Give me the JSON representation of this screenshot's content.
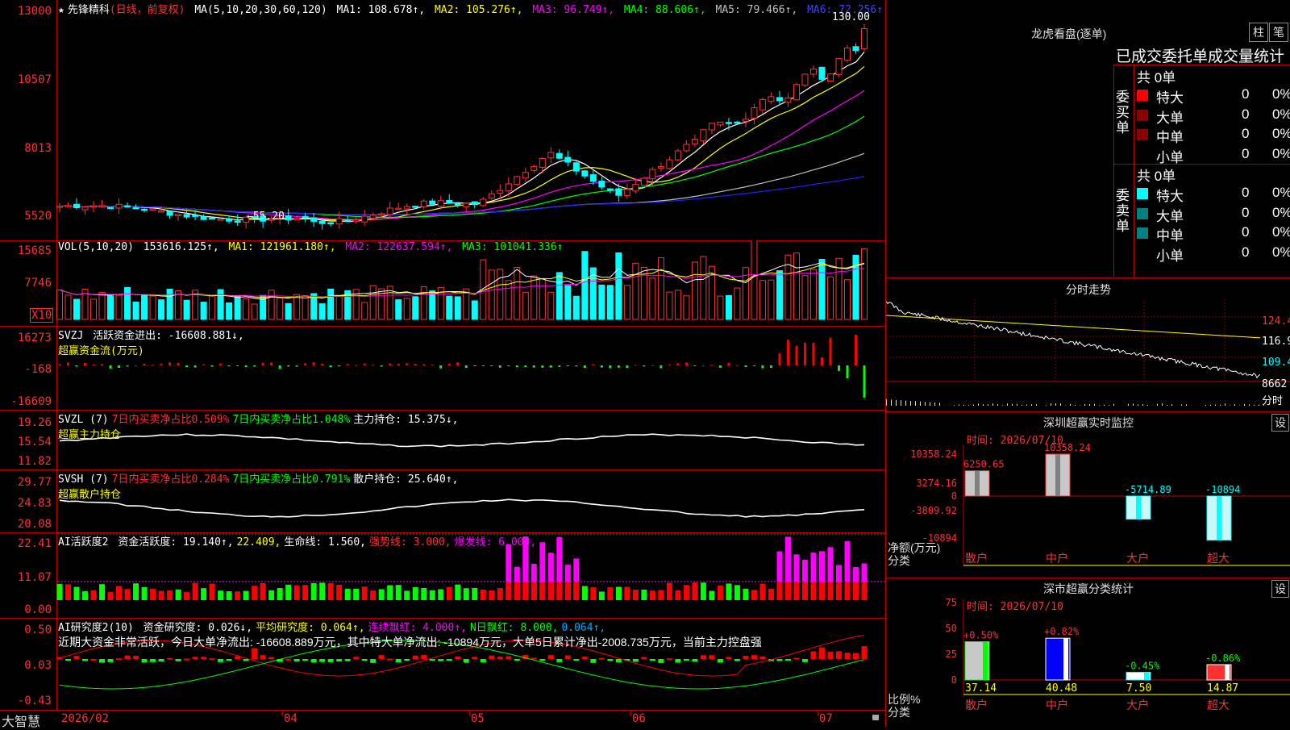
{
  "stock_name": "先锋精科",
  "period": "(日线，前复权)",
  "ma_legend": {
    "label": "MA(5,10,20,30,60,120)",
    "ma1": "MA1: 108.678↑,",
    "ma2": "MA2: 105.276↑,",
    "ma3": "MA3: 96.749↑,",
    "ma4": "MA4: 88.606↑,",
    "ma5": "MA5: 79.466↑,",
    "ma6": "MA6: 72.256↑"
  },
  "price_axis": [
    "13000",
    "10507",
    "8013",
    "5520"
  ],
  "high_label": "130.00",
  "low_label": "←55.20",
  "vol_legend": {
    "label": "VOL(5,10,20)",
    "vol": "153616.125↑,",
    "ma1": "MA1: 121961.180↑,",
    "ma2": "MA2: 122637.594↑,",
    "ma3": "MA3: 101041.336↑"
  },
  "vol_axis": [
    "15685",
    "7746"
  ],
  "vol_unit": "X10",
  "svzj": {
    "label": "SVZJ",
    "value": "活跃资金进出: -16608.881↓,",
    "sub": "超赢资金流(万元)",
    "axis": [
      "16273",
      "-168",
      "-16609"
    ]
  },
  "svzl": {
    "label": "SVZL (7)",
    "a": "7日内买卖净占比0.509%",
    "b": "7日内买卖净占比1.048%",
    "c": "主力持仓: 15.375↓,",
    "sub": "超赢主力持仓",
    "axis": [
      "19.26",
      "15.54",
      "11.82"
    ]
  },
  "svsh": {
    "label": "SVSH (7)",
    "a": "7日内买卖净占比0.284%",
    "b": "7日内买卖净占比0.791%",
    "c": "散户持仓: 25.640↑,",
    "sub": "超赢散户持仓",
    "axis": [
      "29.77",
      "24.83",
      "20.08"
    ]
  },
  "ai1": {
    "label": "AI活跃度2",
    "a": "资金活跃度: 19.140↑,",
    "b": "22.409,",
    "c": "生命线: 1.560,",
    "d": "强势线: 3.000,",
    "e": "爆发线: 6.000,",
    "axis": [
      "22.41",
      "11.07",
      "0.00"
    ]
  },
  "ai2": {
    "label": "AI研究度2(10)",
    "a": "资金研究度: 0.026↓,",
    "b": "平均研究度: 0.064↑,",
    "c": "连续飘红: 4.000↑,",
    "d": "N日飘红: 8.000,",
    "e": "0.064↑,",
    "note": "近期大资金非常活跃，今日大单净流出: -16608.889万元，其中特大单净流出: -10894万元，大单5日累计净出-2008.735万元，当前主力控盘强",
    "axis": [
      "0.50",
      "0.03",
      "-0.43"
    ]
  },
  "bottom": {
    "brand": "大智慧",
    "dates": [
      "2026/02",
      "04",
      "05",
      "06",
      "07"
    ]
  },
  "lhb": {
    "title": "龙虎看盘(逐单)",
    "btn1": "柱",
    "btn2": "笔",
    "header": "已成交委托单成交量统计",
    "buy_label": "委买单",
    "sell_label": "委卖单",
    "buy_total": "共 0单",
    "sell_total": "共 0单",
    "buy_rows": [
      {
        "name": "特大",
        "v": "0",
        "p": "0%"
      },
      {
        "name": "大单",
        "v": "0",
        "p": "0%"
      },
      {
        "name": "中单",
        "v": "0",
        "p": "0%"
      },
      {
        "name": "小单",
        "v": "0",
        "p": "0%"
      }
    ],
    "sell_rows": [
      {
        "name": "特大",
        "v": "0",
        "p": "0%"
      },
      {
        "name": "大单",
        "v": "0",
        "p": "0%"
      },
      {
        "name": "中单",
        "v": "0",
        "p": "0%"
      },
      {
        "name": "小单",
        "v": "0",
        "p": "0%"
      }
    ],
    "buy_colors": [
      "#ff0000",
      "#8b0000",
      "#8b0000",
      "#000000"
    ],
    "sell_colors": [
      "#00ffff",
      "#008080",
      "#008080",
      "#000000"
    ]
  },
  "intraday": {
    "title": "分时走势",
    "axis": [
      "124.4",
      "116.9",
      "109.4",
      "8662",
      "分时"
    ]
  },
  "sz_monitor": {
    "title": "深圳超赢实时监控",
    "settings": "设",
    "time": "时间: 2026/07/10",
    "axis": [
      "10358.24",
      "3274.16",
      "0",
      "-3809.92",
      "-10894"
    ],
    "ylabel": "净额(万元)",
    "xlabel": "分类",
    "labels": [
      "6250.65",
      "10358.24",
      "-5714.89",
      "-10894"
    ],
    "values": [
      6250.65,
      10358.24,
      -5714.89,
      -10894
    ],
    "categories": [
      "散户",
      "中户",
      "大户",
      "超大"
    ]
  },
  "sz_class": {
    "title": "深市超赢分类统计",
    "settings": "设",
    "time": "时间: 2026/07/10",
    "axis": [
      "75",
      "50",
      "25",
      "0"
    ],
    "ylabel": "比例%",
    "xlabel": "分类",
    "pct": [
      "+0.50%",
      "+0.82%",
      "-0.45%",
      "-0.86%"
    ],
    "values": [
      37.14,
      40.48,
      7.5,
      14.87
    ],
    "value_labels": [
      "37.14",
      "40.48",
      "7.50",
      "14.87"
    ],
    "categories": [
      "散户",
      "中户",
      "大户",
      "超大"
    ]
  },
  "colors": {
    "up": "#ff3232",
    "down": "#00ffff",
    "ma1": "#ffffff",
    "ma2": "#ffff00",
    "ma3": "#ff00ff",
    "ma4": "#00ff00",
    "ma5": "#c0c0c0",
    "ma6": "#2020ff"
  }
}
